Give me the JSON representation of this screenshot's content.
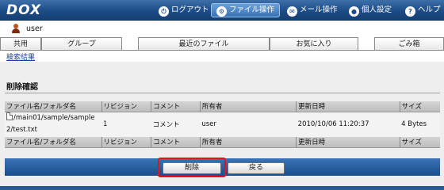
{
  "app": {
    "logo": "DOX"
  },
  "nav": {
    "items": [
      {
        "label": "ログアウト",
        "icon": "power-icon"
      },
      {
        "label": "ファイル操作",
        "icon": "gear-icon",
        "active": true
      },
      {
        "label": "メール操作",
        "icon": "mail-icon"
      },
      {
        "label": "個人設定",
        "icon": "person-icon"
      },
      {
        "label": "ヘルプ",
        "icon": "help-icon"
      }
    ]
  },
  "user": {
    "name": "user"
  },
  "tabs": [
    "共用",
    "グループ",
    "最近のファイル",
    "お気に入り",
    "ごみ箱"
  ],
  "breadcrumb": "検索結果",
  "page": {
    "title": "削除確認"
  },
  "table": {
    "headers": [
      "ファイル名/フォルダ名",
      "リビジョン",
      "コメント",
      "所有者",
      "更新日時",
      "サイズ"
    ],
    "rows": [
      {
        "name": "/main01/sample/sample2/test.txt",
        "revision": "1",
        "comment": "コメント",
        "owner": "user",
        "updated": "2010/10/06 11:20:37",
        "size": "4 Bytes"
      }
    ]
  },
  "buttons": {
    "delete": "削除",
    "back": "戻る"
  },
  "colors": {
    "nav_bg": "#1d4c86",
    "highlight": "#e0141b",
    "button_bar": "#2a5a96"
  }
}
